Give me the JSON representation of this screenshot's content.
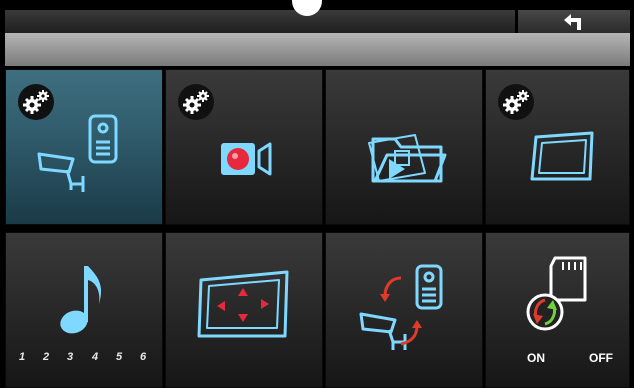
{
  "top_bar": {
    "back_icon": "back-arrow-icon"
  },
  "grid": {
    "tiles": [
      {
        "name": "camera-intercom-settings",
        "active": true,
        "gear": true,
        "icon": "camera-intercom-icon"
      },
      {
        "name": "record-settings",
        "gear": true,
        "icon": "video-record-icon"
      },
      {
        "name": "media-folder",
        "gear": false,
        "icon": "media-folder-icon"
      },
      {
        "name": "display-settings",
        "gear": true,
        "icon": "screen-icon"
      },
      {
        "name": "ringtone",
        "gear": false,
        "icon": "music-note-icon",
        "numbers": [
          "1",
          "2",
          "3",
          "4",
          "5",
          "6"
        ]
      },
      {
        "name": "screen-adjust",
        "gear": false,
        "icon": "screen-arrows-icon"
      },
      {
        "name": "camera-switch",
        "gear": false,
        "icon": "camera-switch-icon"
      },
      {
        "name": "sd-card-auto-record",
        "gear": false,
        "icon": "sd-card-icon",
        "on_label": "ON",
        "off_label": "OFF"
      }
    ]
  },
  "colors": {
    "accent_blue": "#7fd8ff",
    "active_tile": "#2f5a6a",
    "record_red": "#e8283c",
    "arrow_red": "#e03a2a",
    "arrow_green": "#6fd23a"
  }
}
